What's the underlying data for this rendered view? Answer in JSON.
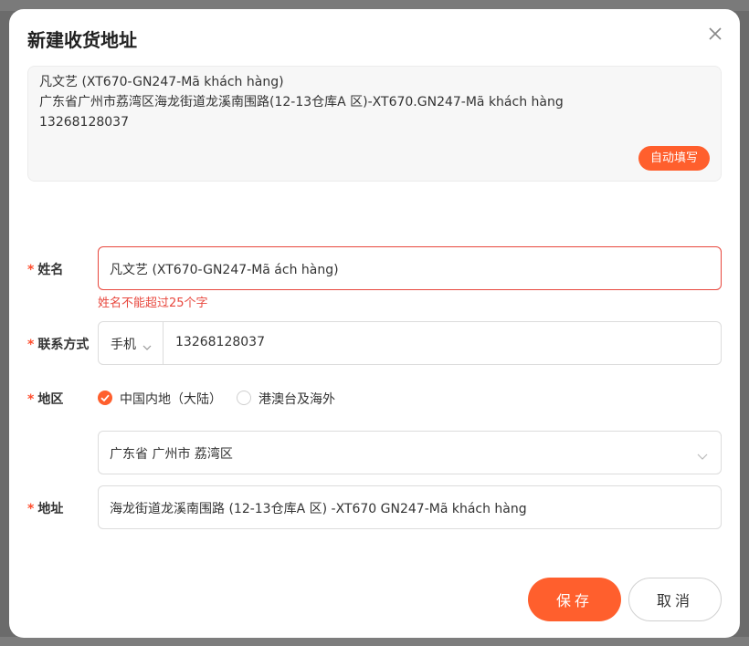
{
  "dialog": {
    "title": "新建收货地址",
    "close_icon": "close-icon"
  },
  "paste_box": {
    "text": "凡文艺 (XT670-GN247-Mã khách hàng)\n广东省广州市荔湾区海龙街道龙溪南围路(12-13仓库A 区)-XT670.GN247-Mã khách hàng\n13268128037",
    "autofill_label": "自动填写"
  },
  "form": {
    "name": {
      "required_mark": "*",
      "label": "姓名",
      "value": "凡文艺 (XT670-GN247-Mã  ách hàng)",
      "error": "姓名不能超过25个字"
    },
    "contact": {
      "required_mark": "*",
      "label": "联系方式",
      "type_value": "手机",
      "phone_value": "13268128037"
    },
    "region": {
      "required_mark": "*",
      "label": "地区",
      "options": [
        {
          "label": "中国内地（大陆）",
          "selected": true
        },
        {
          "label": "港澳台及海外",
          "selected": false
        }
      ],
      "select_value": "广东省 广州市 荔湾区"
    },
    "address": {
      "required_mark": "*",
      "label": "地址",
      "value": "海龙街道龙溪南围路 (12-13仓库A 区) -XT670 GN247-Mã khách hàng"
    }
  },
  "actions": {
    "save_label": "保存",
    "cancel_label": "取消"
  },
  "colors": {
    "accent": "#ff5f2d",
    "error": "#e8473d"
  }
}
